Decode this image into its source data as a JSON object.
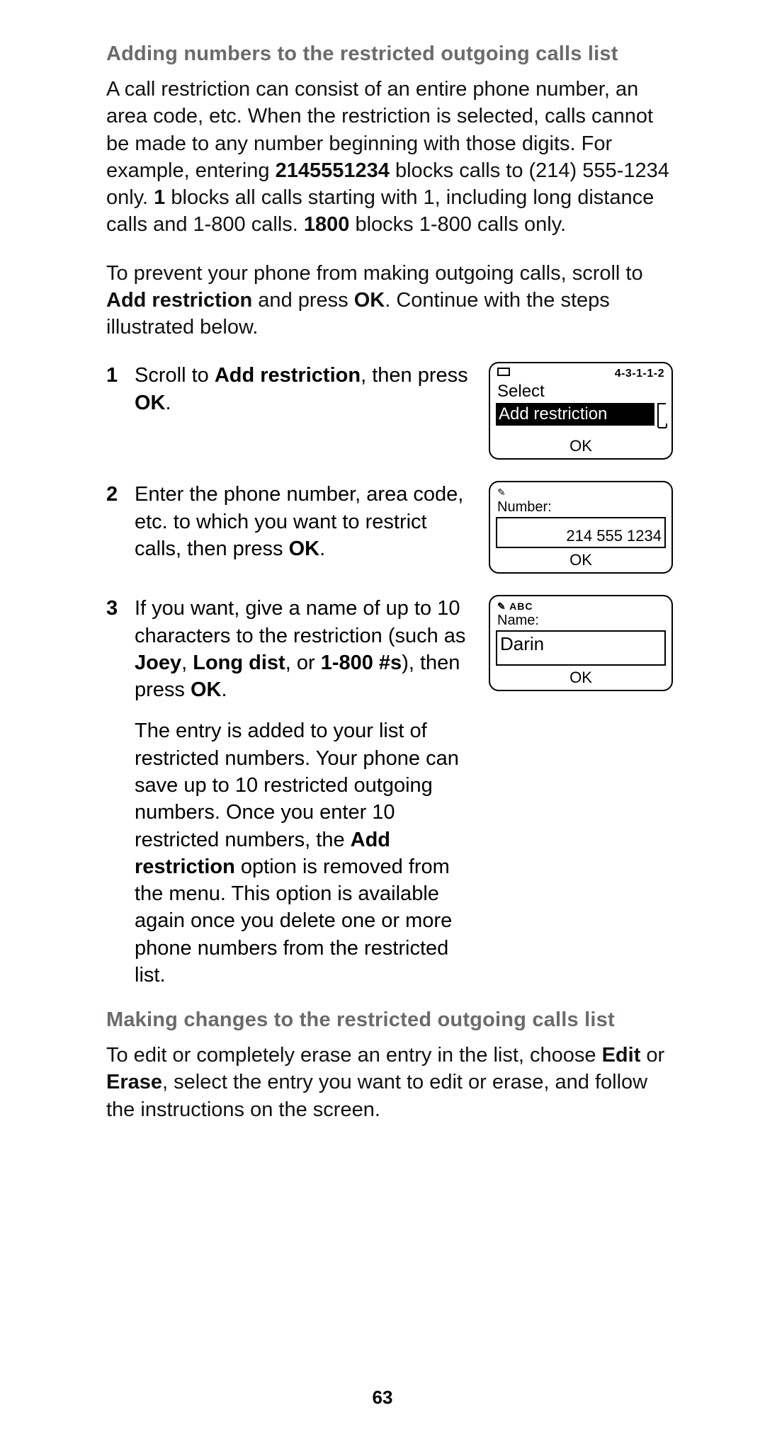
{
  "section1": {
    "heading": "Adding numbers to the restricted outgoing calls list",
    "para1_parts": {
      "p1": "A call restriction can consist of an entire phone number, an area code, etc. When the restriction is selected, calls cannot be made to any number beginning with those digits. For example, entering ",
      "b1": "2145551234",
      "p2": " blocks calls to (214) 555-1234 only. ",
      "b2": "1",
      "p3": " blocks all calls starting with 1, including long distance calls and 1-800 calls. ",
      "b3": "1800",
      "p4": " blocks 1-800 calls only."
    },
    "para2_parts": {
      "p1": "To prevent your phone from making outgoing calls, scroll to ",
      "b1": "Add restriction",
      "p2": " and press ",
      "b2": "OK",
      "p3": ". Continue with the steps illustrated below."
    }
  },
  "steps": {
    "s1": {
      "num": "1",
      "t1": "Scroll to ",
      "b1": "Add restriction",
      "t2": ", then press ",
      "b2": "OK",
      "t3": "."
    },
    "s2": {
      "num": "2",
      "t1": "Enter the phone number, area code, etc. to which you want to restrict calls, then press ",
      "b1": "OK",
      "t2": "."
    },
    "s3": {
      "num": "3",
      "t1": "If you want, give a name of up to 10 characters to the restriction (such as ",
      "b1": "Joey",
      "t2": ", ",
      "b2": "Long dist",
      "t3": ", or ",
      "b3": "1-800 #s",
      "t4": "), then press ",
      "b4": "OK",
      "t5": ".",
      "follow_p1": "The entry is added to your list of restricted numbers. Your phone can save up to 10 restricted outgoing numbers. Once you enter 10 restricted numbers, the ",
      "follow_b1": "Add restriction",
      "follow_p2": " option is removed from the menu. This option is available again once you delete one or more phone numbers from the restricted list."
    }
  },
  "screens": {
    "s1": {
      "menu_code": "4-3-1-1-2",
      "select_label": "Select",
      "highlighted": "Add restriction",
      "ok": "OK"
    },
    "s2": {
      "icon": "✎",
      "label": "Number:",
      "value": "214 555 1234",
      "ok": "OK"
    },
    "s3": {
      "mode": "✎ ABC",
      "label": "Name:",
      "value": "Darin",
      "ok": "OK"
    }
  },
  "section2": {
    "heading": "Making changes to the restricted outgoing calls list",
    "para_parts": {
      "p1": "To edit or completely erase an entry in the list, choose ",
      "b1": "Edit",
      "p2": " or ",
      "b2": "Erase",
      "p3": ", select the entry you want to edit or erase, and follow the instructions on the screen."
    }
  },
  "page_number": "63"
}
